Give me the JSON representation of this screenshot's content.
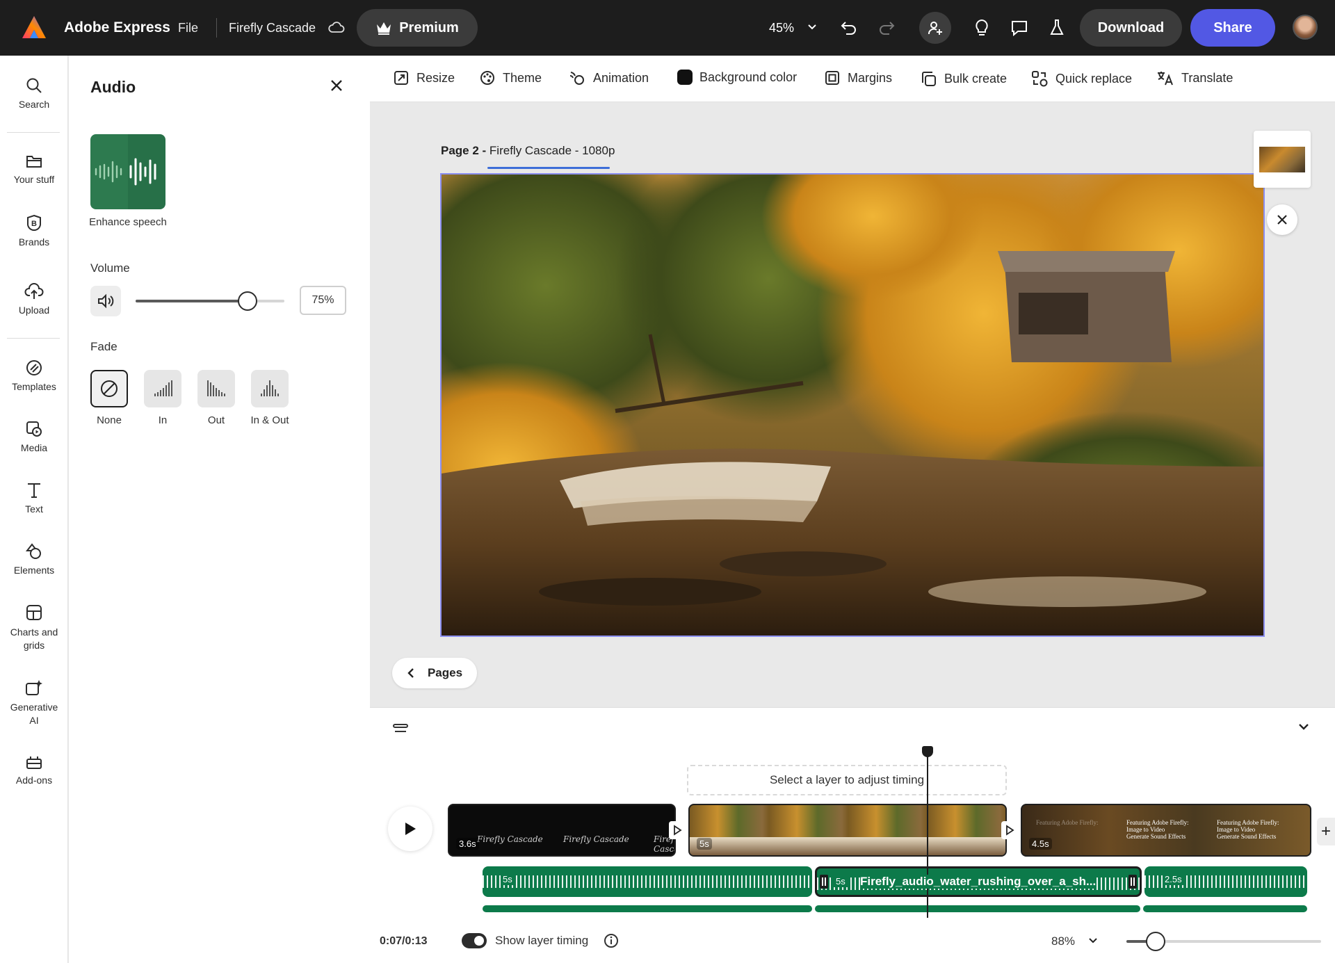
{
  "topbar": {
    "app_name": "Adobe Express",
    "file_label": "File",
    "doc_title": "Firefly Cascade",
    "premium_label": "Premium",
    "zoom": "45%",
    "download_label": "Download",
    "share_label": "Share",
    "share_color": "#5258e4"
  },
  "rail": {
    "items": [
      {
        "label": "Search",
        "icon": "search-icon"
      },
      {
        "label": "Your stuff",
        "icon": "folder-icon"
      },
      {
        "label": "Brands",
        "icon": "brand-icon"
      },
      {
        "label": "Upload",
        "icon": "upload-icon"
      },
      {
        "label": "Templates",
        "icon": "templates-icon"
      },
      {
        "label": "Media",
        "icon": "media-icon"
      },
      {
        "label": "Text",
        "icon": "text-icon"
      },
      {
        "label": "Elements",
        "icon": "elements-icon"
      },
      {
        "label": "Charts and grids",
        "icon": "charts-grid-icon"
      },
      {
        "label": "Generative AI",
        "icon": "generative-ai-icon"
      },
      {
        "label": "Add-ons",
        "icon": "addons-icon"
      }
    ]
  },
  "audio_panel": {
    "title": "Audio",
    "enhance_label": "Enhance speech",
    "volume_label": "Volume",
    "volume_value": "75%",
    "volume_level": 0.75,
    "fade_label": "Fade",
    "fade_options": [
      {
        "label": "None",
        "selected": true
      },
      {
        "label": "In",
        "selected": false
      },
      {
        "label": "Out",
        "selected": false
      },
      {
        "label": "In & Out",
        "selected": false
      }
    ]
  },
  "toolbar": {
    "tools": [
      {
        "label": "Resize",
        "icon": "resize-icon"
      },
      {
        "label": "Theme",
        "icon": "theme-icon"
      },
      {
        "label": "Animation",
        "icon": "animation-icon"
      },
      {
        "label": "Background color",
        "icon": "background-color-icon"
      },
      {
        "label": "Margins",
        "icon": "margins-icon"
      },
      {
        "label": "Bulk create",
        "icon": "bulk-create-icon"
      },
      {
        "label": "Quick replace",
        "icon": "quick-replace-icon"
      },
      {
        "label": "Translate",
        "icon": "translate-icon"
      }
    ]
  },
  "canvas": {
    "page_prefix": "Page 2 - ",
    "page_name": "Firefly Cascade - 1080p",
    "pages_button": "Pages"
  },
  "timeline": {
    "hint": "Select a layer to adjust timing",
    "clips": [
      {
        "duration": "3.6s",
        "script_text": "Firefly Cascade"
      },
      {
        "duration": "5s"
      },
      {
        "duration": "4.5s",
        "overlay_line1": "Featuring Adobe Firefly:",
        "overlay_line2": "Image to Video",
        "overlay_line3": "Generate Sound Effects"
      }
    ],
    "audio": [
      {
        "duration": "5s"
      },
      {
        "duration": "5s",
        "name": "Firefly_audio_water_rushing_over_a_sh..."
      },
      {
        "duration": "2.5s"
      }
    ],
    "time": "0:07/0:13",
    "show_layer_timing": "Show layer timing",
    "zoom": "88%",
    "zoom_level": 0.15
  }
}
